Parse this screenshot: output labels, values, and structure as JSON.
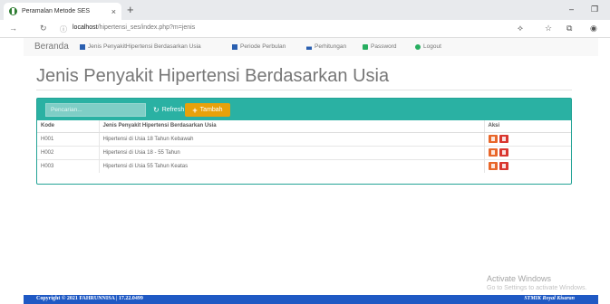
{
  "browser": {
    "tab_title": "Peramalan Metode SES",
    "tab_close": "×",
    "new_tab": "+",
    "url_host": "localhost",
    "url_path": "/hipertensi_ses/index.php?m=jenis",
    "minimize": "–",
    "restore": "❐"
  },
  "navbar": {
    "brand": "Beranda",
    "items": [
      {
        "label": "Jenis PenyakitHipertensi Berdasarkan Usia",
        "icon": "grid-icon",
        "color": "#2a5fb0"
      },
      {
        "label": "Periode Perbulan",
        "icon": "calendar-icon",
        "color": "#2a5fb0"
      },
      {
        "label": "Perhitungan",
        "icon": "bar-chart-icon",
        "color": "#2a5fb0"
      },
      {
        "label": "Password",
        "icon": "lock-icon",
        "color": "#27ae60"
      },
      {
        "label": "Logout",
        "icon": "logout-icon",
        "color": "#27ae60"
      }
    ]
  },
  "page": {
    "title": "Jenis Penyakit Hipertensi Berdasarkan Usia"
  },
  "toolbar": {
    "search_placeholder": "Pencarian...",
    "refresh_label": "Refresh",
    "tambah_label": "Tambah"
  },
  "table": {
    "headers": [
      "Kode",
      "Jenis Penyakit Hipertensi Berdasarkan Usia",
      "Aksi"
    ],
    "rows": [
      {
        "kode": "H001",
        "jenis": "Hipertensi di Usia 18 Tahun Kebawah"
      },
      {
        "kode": "H002",
        "jenis": "Hipertensi di Usia 18 - 55 Tahun"
      },
      {
        "kode": "H003",
        "jenis": "Hipertensi di Usia 55 Tahun Keatas"
      }
    ]
  },
  "watermark": {
    "line1": "Activate Windows",
    "line2": "Go to Settings to activate Windows."
  },
  "footer": {
    "left": "Copyright © 2021 FAHRUNNISA | 17.22.0499",
    "right": "STMIK Royal Kisaran"
  },
  "colors": {
    "panel_head": "#2ab1a3",
    "tambah": "#e8a10b",
    "edit": "#e8672a",
    "delete": "#d9362f",
    "footer": "#1f59c4"
  }
}
